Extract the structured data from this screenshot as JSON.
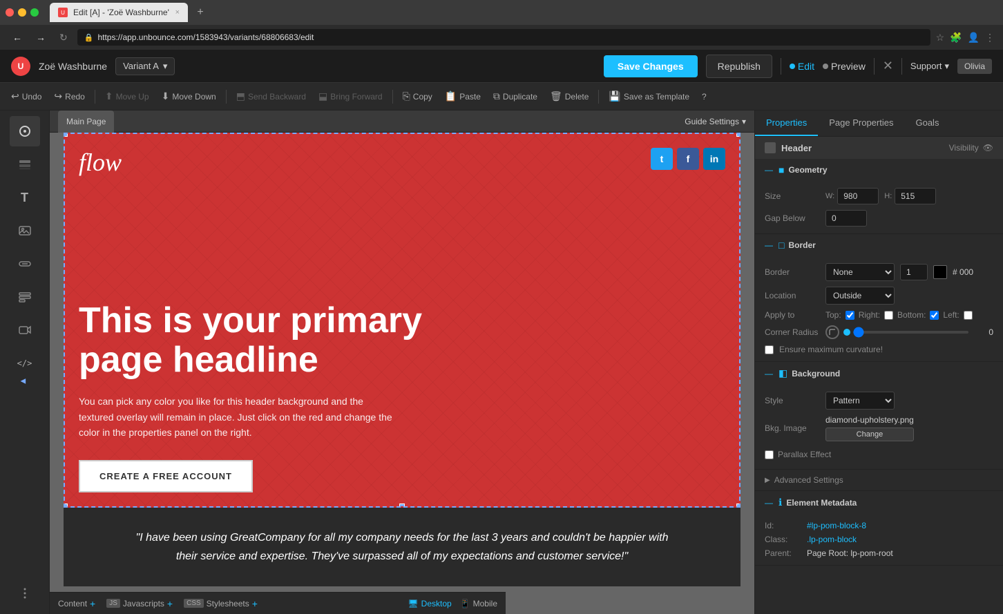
{
  "browser": {
    "tab_title": "Edit [A] - 'Zoë Washburne'",
    "url": "https://app.unbounce.com/1583943/variants/68806683/edit",
    "close_label": "×",
    "plus_label": "+"
  },
  "app_header": {
    "logo_letter": "U",
    "page_name": "Zoë Washburne",
    "variant_label": "Variant A",
    "variant_chevron": "▾",
    "save_changes": "Save Changes",
    "republish": "Republish",
    "edit_label": "Edit",
    "preview_label": "Preview",
    "close_label": "✕",
    "support_label": "Support",
    "support_chevron": "▾",
    "user_label": "Olivia"
  },
  "toolbar": {
    "undo": "Undo",
    "redo": "Redo",
    "move_up": "Move Up",
    "move_down": "Move Down",
    "send_backward": "Send Backward",
    "bring_forward": "Bring Forward",
    "copy": "Copy",
    "paste": "Paste",
    "duplicate": "Duplicate",
    "delete": "Delete",
    "save_template": "Save as Template",
    "help": "?"
  },
  "canvas": {
    "main_page_label": "Main Page",
    "guide_settings": "Guide Settings",
    "guide_chevron": "▾"
  },
  "page_content": {
    "logo": "flow",
    "social_twitter": "t",
    "social_facebook": "f",
    "social_linkedin": "in",
    "headline": "This is your primary page headline",
    "body_text": "You can pick any color you like for this header background and the textured overlay will remain in place. Just click on the red and change the color in the properties panel on the right.",
    "cta_label": "CREATE A FREE ACCOUNT",
    "testimonial": "\"I have been using GreatCompany for all my company needs for the last 3 years and couldn't be happier with their service and expertise. They've surpassed all of my expectations and customer service!\""
  },
  "right_panel": {
    "tabs": {
      "properties": "Properties",
      "page_properties": "Page Properties",
      "goals": "Goals"
    },
    "header_label": "Header",
    "visibility_label": "Visibility",
    "sections": {
      "geometry": {
        "title": "Geometry",
        "size_label": "Size",
        "width_label": "W:",
        "width_value": "980",
        "height_label": "H:",
        "height_value": "515",
        "gap_label": "Gap Below",
        "gap_value": "0"
      },
      "border": {
        "title": "Border",
        "border_label": "Border",
        "border_value": "None",
        "border_thickness": "1",
        "border_color": "#000000",
        "border_hex": "000",
        "location_label": "Location",
        "location_value": "Outside",
        "apply_label": "Apply to",
        "top_label": "Top:",
        "top_checked": true,
        "right_label": "Right:",
        "right_checked": false,
        "bottom_label": "Bottom:",
        "bottom_checked": true,
        "left_label": "Left:",
        "left_checked": false,
        "corner_label": "Corner Radius",
        "corner_value": "0",
        "curvature_label": "Ensure maximum curvature!"
      },
      "background": {
        "title": "Background",
        "style_label": "Style",
        "style_value": "Pattern",
        "bkg_image_label": "Bkg. Image",
        "bkg_image_value": "diamond-upholstery.png",
        "change_btn": "Change",
        "parallax_label": "Parallax Effect"
      },
      "advanced": {
        "title": "Advanced Settings"
      },
      "element_metadata": {
        "title": "Element Metadata",
        "id_label": "Id:",
        "id_value": "#lp-pom-block-8",
        "class_label": "Class:",
        "class_value": ".lp-pom-block",
        "parent_label": "Parent:",
        "parent_value": "Page Root: lp-pom-root"
      }
    }
  },
  "bottom_bar": {
    "content_label": "Content",
    "plus_content": "+",
    "js_label": "JS",
    "javascripts_label": "Javascripts",
    "plus_js": "+",
    "css_label": "CSS",
    "stylesheets_label": "Stylesheets",
    "plus_css": "+",
    "desktop_label": "Desktop",
    "mobile_label": "Mobile"
  },
  "colors": {
    "header_bg": "#cc3333",
    "accent": "#1dbfff",
    "panel_bg": "#2a2a2a",
    "canvas_bg": "#666666"
  },
  "icons": {
    "undo": "↩",
    "redo": "↪",
    "move_up": "▲",
    "move_down": "▼",
    "send_backward": "⬒",
    "bring_forward": "⬓",
    "copy": "⎘",
    "paste": "📋",
    "duplicate": "⧉",
    "delete": "🗑",
    "save_template": "💾",
    "collapse": "—",
    "expand": "▶",
    "eye": "👁",
    "chevron_down": "▾",
    "desktop": "🖥",
    "mobile": "📱",
    "gear": "⚙",
    "text_tool": "T",
    "image_tool": "🖼",
    "button_tool": "⬜",
    "form_tool": "≡",
    "video_tool": "▶",
    "code_tool": "</>",
    "more_tool": "•••"
  }
}
